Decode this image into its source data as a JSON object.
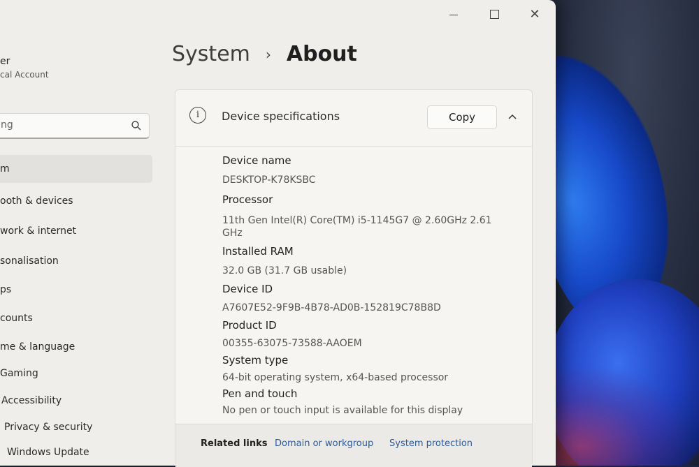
{
  "window": {
    "controls": {
      "minimize": "minimize",
      "maximize": "maximize",
      "close": "✕"
    }
  },
  "user": {
    "name": "er",
    "account": "cal Account"
  },
  "search": {
    "placeholder": "ng"
  },
  "sidebar": {
    "items": [
      {
        "label": "m",
        "active": true
      },
      {
        "label": "ooth & devices"
      },
      {
        "label": "work & internet"
      },
      {
        "label": "sonalisation"
      },
      {
        "label": "ps"
      },
      {
        "label": "counts"
      },
      {
        "label": "me & language"
      },
      {
        "label": "Gaming"
      },
      {
        "label": "Accessibility"
      },
      {
        "label": "Privacy & security"
      },
      {
        "label": "Windows Update"
      }
    ]
  },
  "breadcrumb": {
    "parent": "System",
    "separator": "›",
    "current": "About"
  },
  "card": {
    "title": "Device specifications",
    "copy_label": "Copy",
    "specs": [
      {
        "label": "Device name",
        "value": "DESKTOP-K78KSBC"
      },
      {
        "label": "Processor",
        "value": "11th Gen Intel(R) Core(TM) i5-1145G7 @ 2.60GHz   2.61 GHz"
      },
      {
        "label": "Installed RAM",
        "value": "32.0 GB (31.7 GB usable)"
      },
      {
        "label": "Device ID",
        "value": "A7607E52-9F9B-4B78-AD0B-152819C78B8D"
      },
      {
        "label": "Product ID",
        "value": "00355-63075-73588-AAOEM"
      },
      {
        "label": "System type",
        "value": "64-bit operating system, x64-based processor"
      },
      {
        "label": "Pen and touch",
        "value": "No pen or touch input is available for this display"
      }
    ]
  },
  "related": {
    "title": "Related links",
    "links": [
      "Domain or workgroup",
      "System protection"
    ]
  },
  "colors": {
    "link": "#2a5a9a",
    "window_bg": "#efeeeb",
    "wallpaper_accent": "#1749c9"
  }
}
